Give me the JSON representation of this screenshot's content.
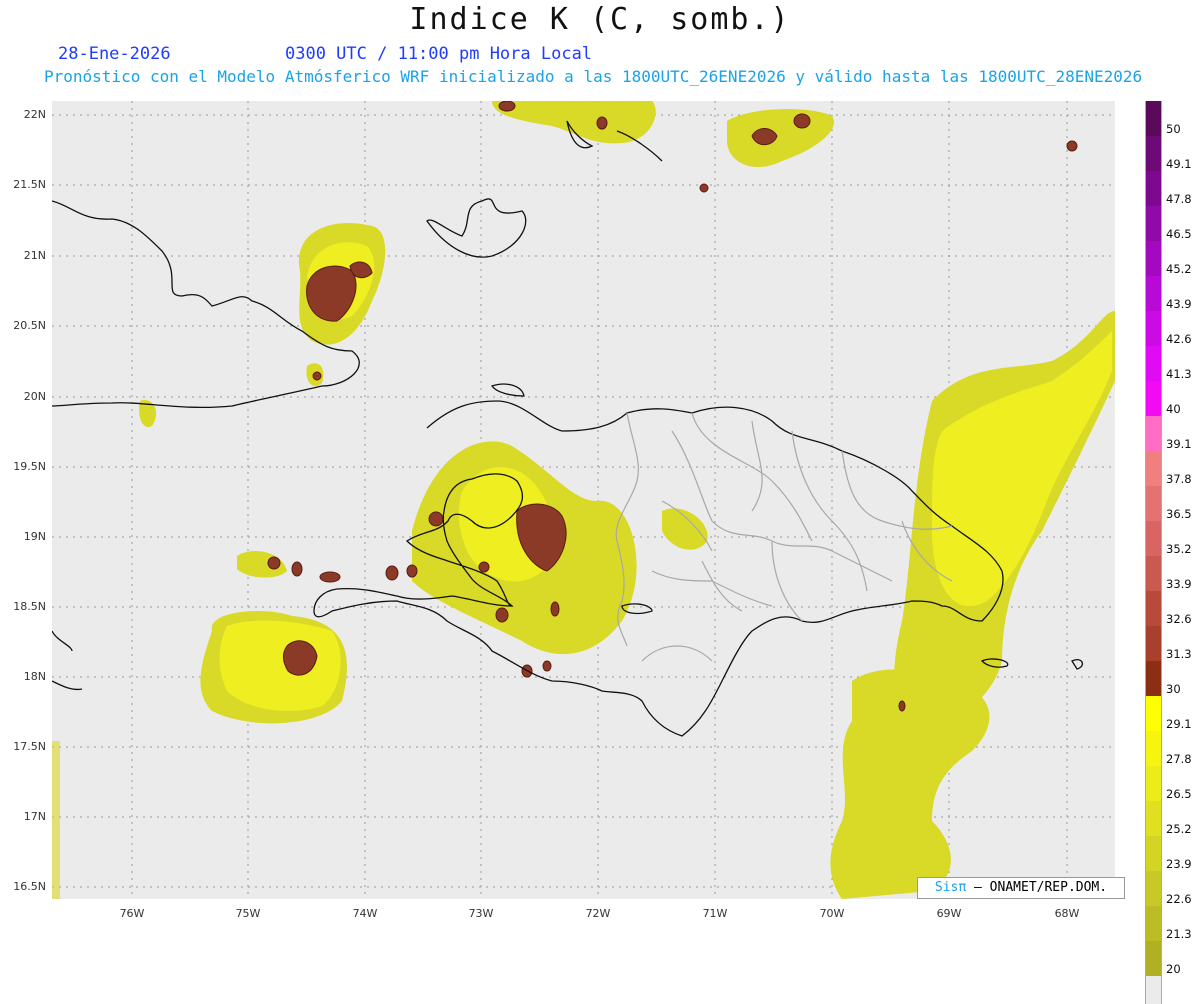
{
  "header": {
    "title": "Indice K (C, somb.)",
    "date": "28-Ene-2026",
    "time": "0300 UTC / 11:00 pm Hora Local",
    "description": "Pronóstico con el Modelo Atmósferico WRF inicializado a las 1800UTC_26ENE2026 y válido hasta las  1800UTC_28ENE2026"
  },
  "axes": {
    "lat_labels": [
      "22N",
      "21.5N",
      "21N",
      "20.5N",
      "20N",
      "19.5N",
      "19N",
      "18.5N",
      "18N",
      "17.5N",
      "17N",
      "16.5N"
    ],
    "lon_labels": [
      "76W",
      "75W",
      "74W",
      "73W",
      "72W",
      "71W",
      "70W",
      "69W",
      "68W"
    ]
  },
  "colorbar": {
    "labels": [
      "50",
      "49.1",
      "47.8",
      "46.5",
      "45.2",
      "43.9",
      "42.6",
      "41.3",
      "40",
      "39.1",
      "37.8",
      "36.5",
      "35.2",
      "33.9",
      "32.6",
      "31.3",
      "30",
      "29.1",
      "27.8",
      "26.5",
      "25.2",
      "23.9",
      "22.6",
      "21.3",
      "20"
    ],
    "colors": [
      "#5b0a5b",
      "#6e0a78",
      "#7d0a8e",
      "#8f0aa6",
      "#a30abf",
      "#b80ad6",
      "#cc0ae6",
      "#e00af5",
      "#f20af2",
      "#ff6ec4",
      "#f08080",
      "#e47272",
      "#d86464",
      "#c85a50",
      "#b84a3c",
      "#a8402e",
      "#8b2e14",
      "#ffff00",
      "#f7f410",
      "#ecec1a",
      "#e0e020",
      "#d4d424",
      "#c8c826",
      "#bcbc26",
      "#b0b022"
    ]
  },
  "credit": {
    "brand": "Sisπ",
    "text": "– ONAMET/REP.DOM."
  }
}
